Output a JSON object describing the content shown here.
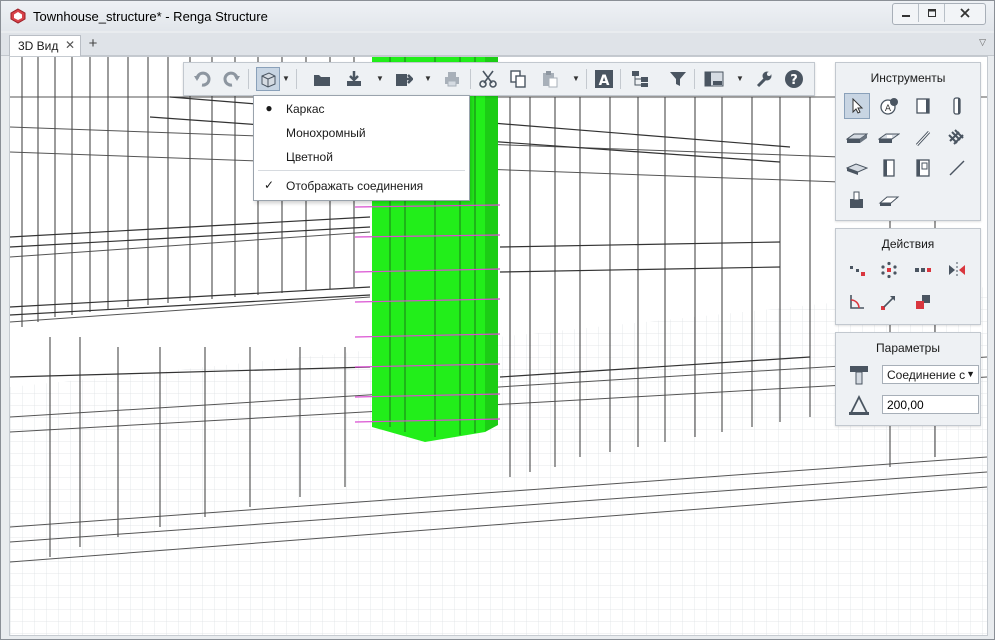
{
  "window": {
    "title": "Townhouse_structure* - Renga Structure",
    "controls": {
      "minimize": "minimize-icon",
      "restore": "restore-icon",
      "close": "close-icon"
    }
  },
  "tabs": {
    "active_label": "3D Вид",
    "close_glyph": "✕",
    "add_glyph": "+",
    "menu_glyph": "▽"
  },
  "toolbar": {
    "icons": [
      "undo-icon",
      "redo-icon",
      "view-style-icon",
      "open-icon",
      "import-icon",
      "export-icon",
      "print-icon",
      "cut-icon",
      "copy-icon",
      "paste-icon",
      "text-style-icon",
      "hierarchy-icon",
      "filter-icon",
      "views-icon",
      "settings-icon",
      "help-icon"
    ]
  },
  "view_menu": {
    "items": [
      {
        "label": "Каркас",
        "mark": "●"
      },
      {
        "label": "Монохромный",
        "mark": ""
      },
      {
        "label": "Цветной",
        "mark": ""
      },
      {
        "label": "Отображать соединения",
        "mark": "✓"
      }
    ]
  },
  "panels": {
    "tools": {
      "title": "Инструменты",
      "icons": [
        "select-icon",
        "axis-icon",
        "column-icon",
        "beam-icon",
        "slab-icon",
        "opening-icon",
        "rebar-icon",
        "rebar-mesh-icon",
        "foundation-icon",
        "wall-icon",
        "window-icon",
        "line-icon",
        "stair-icon",
        "ramp-icon"
      ]
    },
    "actions": {
      "title": "Действия",
      "icons": [
        "move-icon",
        "rotate-points-icon",
        "array-icon",
        "mirror-icon",
        "angle-icon",
        "scale-icon",
        "join-icon"
      ]
    },
    "params": {
      "title": "Параметры",
      "connection_value": "Соединение с",
      "size_value": "200,00"
    }
  },
  "colors": {
    "column_green": "#22ee1a",
    "rebar_highlight": "#d94dd1",
    "active_button": "#c8d5e3"
  }
}
